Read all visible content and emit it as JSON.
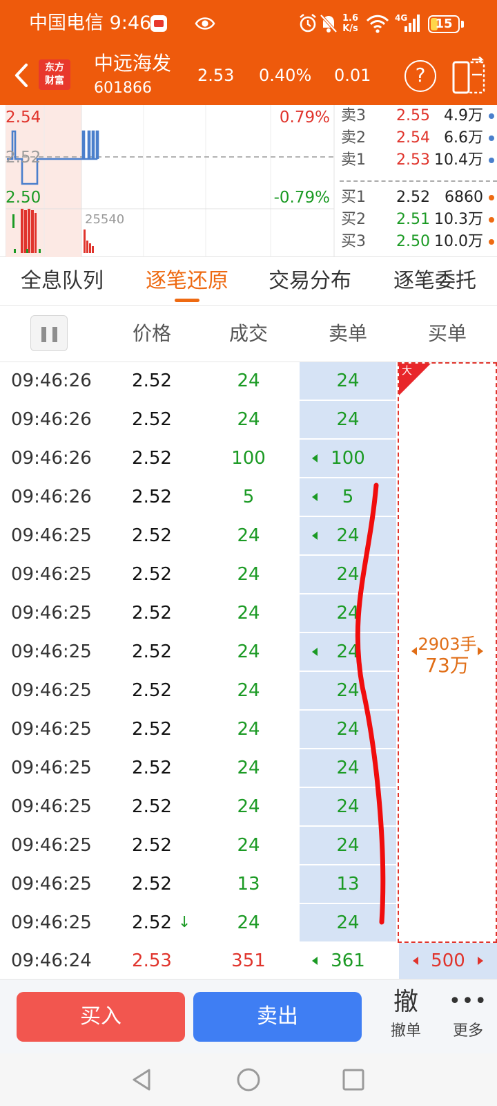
{
  "status_bar": {
    "carrier": "中国电信",
    "time": "9:46",
    "speed_top": "1.6",
    "speed_bottom": "K/s",
    "network": "4G",
    "battery": "15",
    "icons": [
      "app-notification-icon",
      "eye-icon",
      "alarm-icon",
      "mute-icon",
      "wifi-icon",
      "signal-icon",
      "battery-icon"
    ]
  },
  "header": {
    "logo_line1": "东方",
    "logo_line2": "财富",
    "name": "中远海发",
    "code": "601866",
    "price": "2.53",
    "change_pct": "0.40%",
    "change": "0.01",
    "help": "?",
    "accent": "#ee5a0c"
  },
  "chart": {
    "top_price": "2.54",
    "mid_price": "2.52",
    "bottom_price": "2.50",
    "top_pct": "0.79%",
    "bottom_pct": "-0.79%",
    "volume_label": "25540"
  },
  "order_book": {
    "asks": [
      {
        "label": "卖3",
        "price": "2.55",
        "volume": "4.9万"
      },
      {
        "label": "卖2",
        "price": "2.54",
        "volume": "6.6万"
      },
      {
        "label": "卖1",
        "price": "2.53",
        "volume": "10.4万"
      }
    ],
    "bids": [
      {
        "label": "买1",
        "price": "2.52",
        "volume": "6860"
      },
      {
        "label": "买2",
        "price": "2.51",
        "volume": "10.3万"
      },
      {
        "label": "买3",
        "price": "2.50",
        "volume": "10.0万"
      }
    ]
  },
  "tabs": [
    {
      "label": "全息队列",
      "active": false
    },
    {
      "label": "逐笔还原",
      "active": true
    },
    {
      "label": "交易分布",
      "active": false
    },
    {
      "label": "逐笔委托",
      "active": false
    }
  ],
  "columns": {
    "price": "价格",
    "volume": "成交",
    "sell": "卖单",
    "buy": "买单"
  },
  "ticks": [
    {
      "time": "09:46:26",
      "price": "2.52",
      "volume": "24",
      "sell": "24",
      "marker": false
    },
    {
      "time": "09:46:26",
      "price": "2.52",
      "volume": "24",
      "sell": "24",
      "marker": false
    },
    {
      "time": "09:46:26",
      "price": "2.52",
      "volume": "100",
      "sell": "100",
      "marker": true
    },
    {
      "time": "09:46:26",
      "price": "2.52",
      "volume": "5",
      "sell": "5",
      "marker": true
    },
    {
      "time": "09:46:25",
      "price": "2.52",
      "volume": "24",
      "sell": "24",
      "marker": true
    },
    {
      "time": "09:46:25",
      "price": "2.52",
      "volume": "24",
      "sell": "24",
      "marker": false
    },
    {
      "time": "09:46:25",
      "price": "2.52",
      "volume": "24",
      "sell": "24",
      "marker": false
    },
    {
      "time": "09:46:25",
      "price": "2.52",
      "volume": "24",
      "sell": "24",
      "marker": true
    },
    {
      "time": "09:46:25",
      "price": "2.52",
      "volume": "24",
      "sell": "24",
      "marker": false
    },
    {
      "time": "09:46:25",
      "price": "2.52",
      "volume": "24",
      "sell": "24",
      "marker": false
    },
    {
      "time": "09:46:25",
      "price": "2.52",
      "volume": "24",
      "sell": "24",
      "marker": false
    },
    {
      "time": "09:46:25",
      "price": "2.52",
      "volume": "24",
      "sell": "24",
      "marker": false
    },
    {
      "time": "09:46:25",
      "price": "2.52",
      "volume": "24",
      "sell": "24",
      "marker": false
    },
    {
      "time": "09:46:25",
      "price": "2.52",
      "volume": "13",
      "sell": "13",
      "marker": false
    },
    {
      "time": "09:46:25",
      "price": "2.52",
      "volume": "24",
      "sell": "24",
      "marker": false,
      "down": "↓"
    }
  ],
  "buy_order": {
    "badge": "大",
    "lots": "2903手",
    "amount": "73万"
  },
  "last_tick": {
    "time": "09:46:24",
    "price": "2.53",
    "volume": "351",
    "sell": "361",
    "buy": "500"
  },
  "actions": {
    "buy": "买入",
    "sell": "卖出",
    "cancel_glyph": "撤",
    "cancel_label": "撤单",
    "more_glyph": "•••",
    "more_label": "更多"
  },
  "colors": {
    "up": "#e0342c",
    "down": "#1b9a24",
    "accent": "#ee6a12",
    "sell_bg": "#d6e3f5"
  }
}
